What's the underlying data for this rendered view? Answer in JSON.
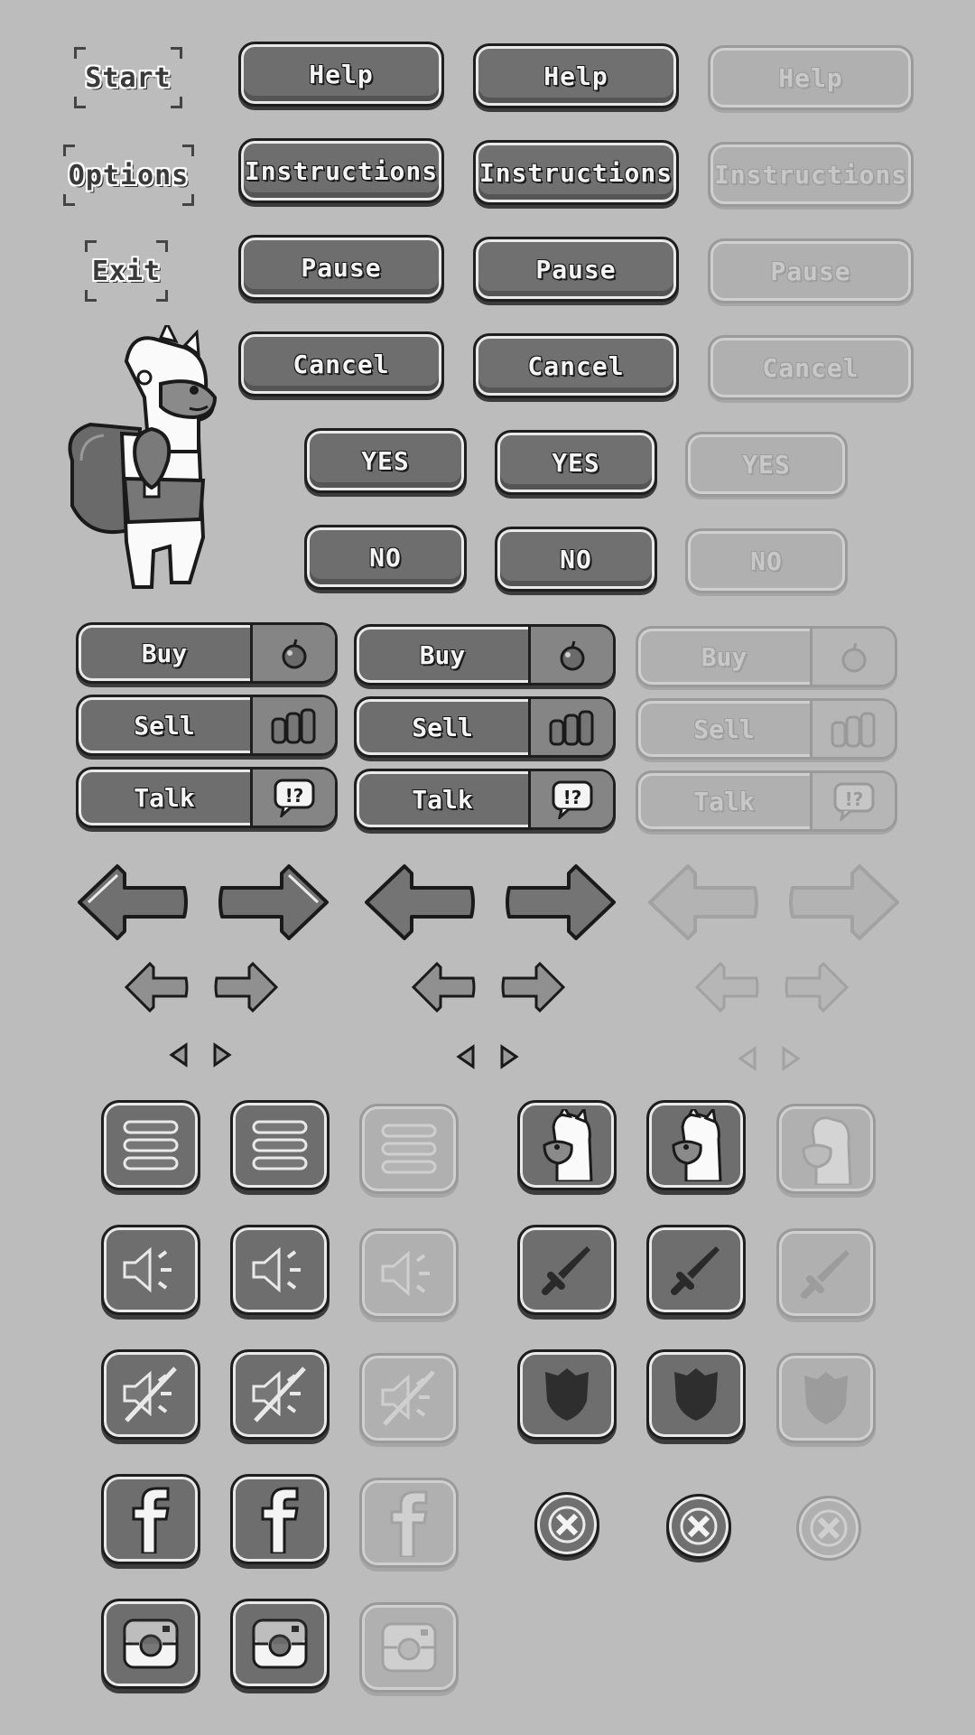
{
  "menu": {
    "start": "Start",
    "options": "Options",
    "exit": "Exit"
  },
  "buttons": {
    "help": "Help",
    "instructions": "Instructions",
    "pause": "Pause",
    "cancel": "Cancel",
    "yes": "YES",
    "no": "NO"
  },
  "shop": {
    "buy": "Buy",
    "sell": "Sell",
    "talk": "Talk"
  },
  "icons": {
    "buy": "apple-icon",
    "sell": "coins-icon",
    "talk": "speech-bubble-icon",
    "arrow_left": "arrow-left-icon",
    "arrow_right": "arrow-right-icon",
    "menu": "hamburger-menu-icon",
    "alpaca": "alpaca-portrait-icon",
    "sound_on": "speaker-on-icon",
    "sound_off": "speaker-muted-icon",
    "sword": "sword-icon",
    "shield": "shield-icon",
    "facebook": "facebook-icon",
    "instagram": "instagram-icon",
    "close": "close-x-icon"
  },
  "colors": {
    "background": "#bcbcbc",
    "button_fill": "#6e6e6e",
    "button_outline": "#1e1e1e",
    "button_highlight": "#e9e9e9",
    "disabled_fill": "#b0b0b0"
  }
}
